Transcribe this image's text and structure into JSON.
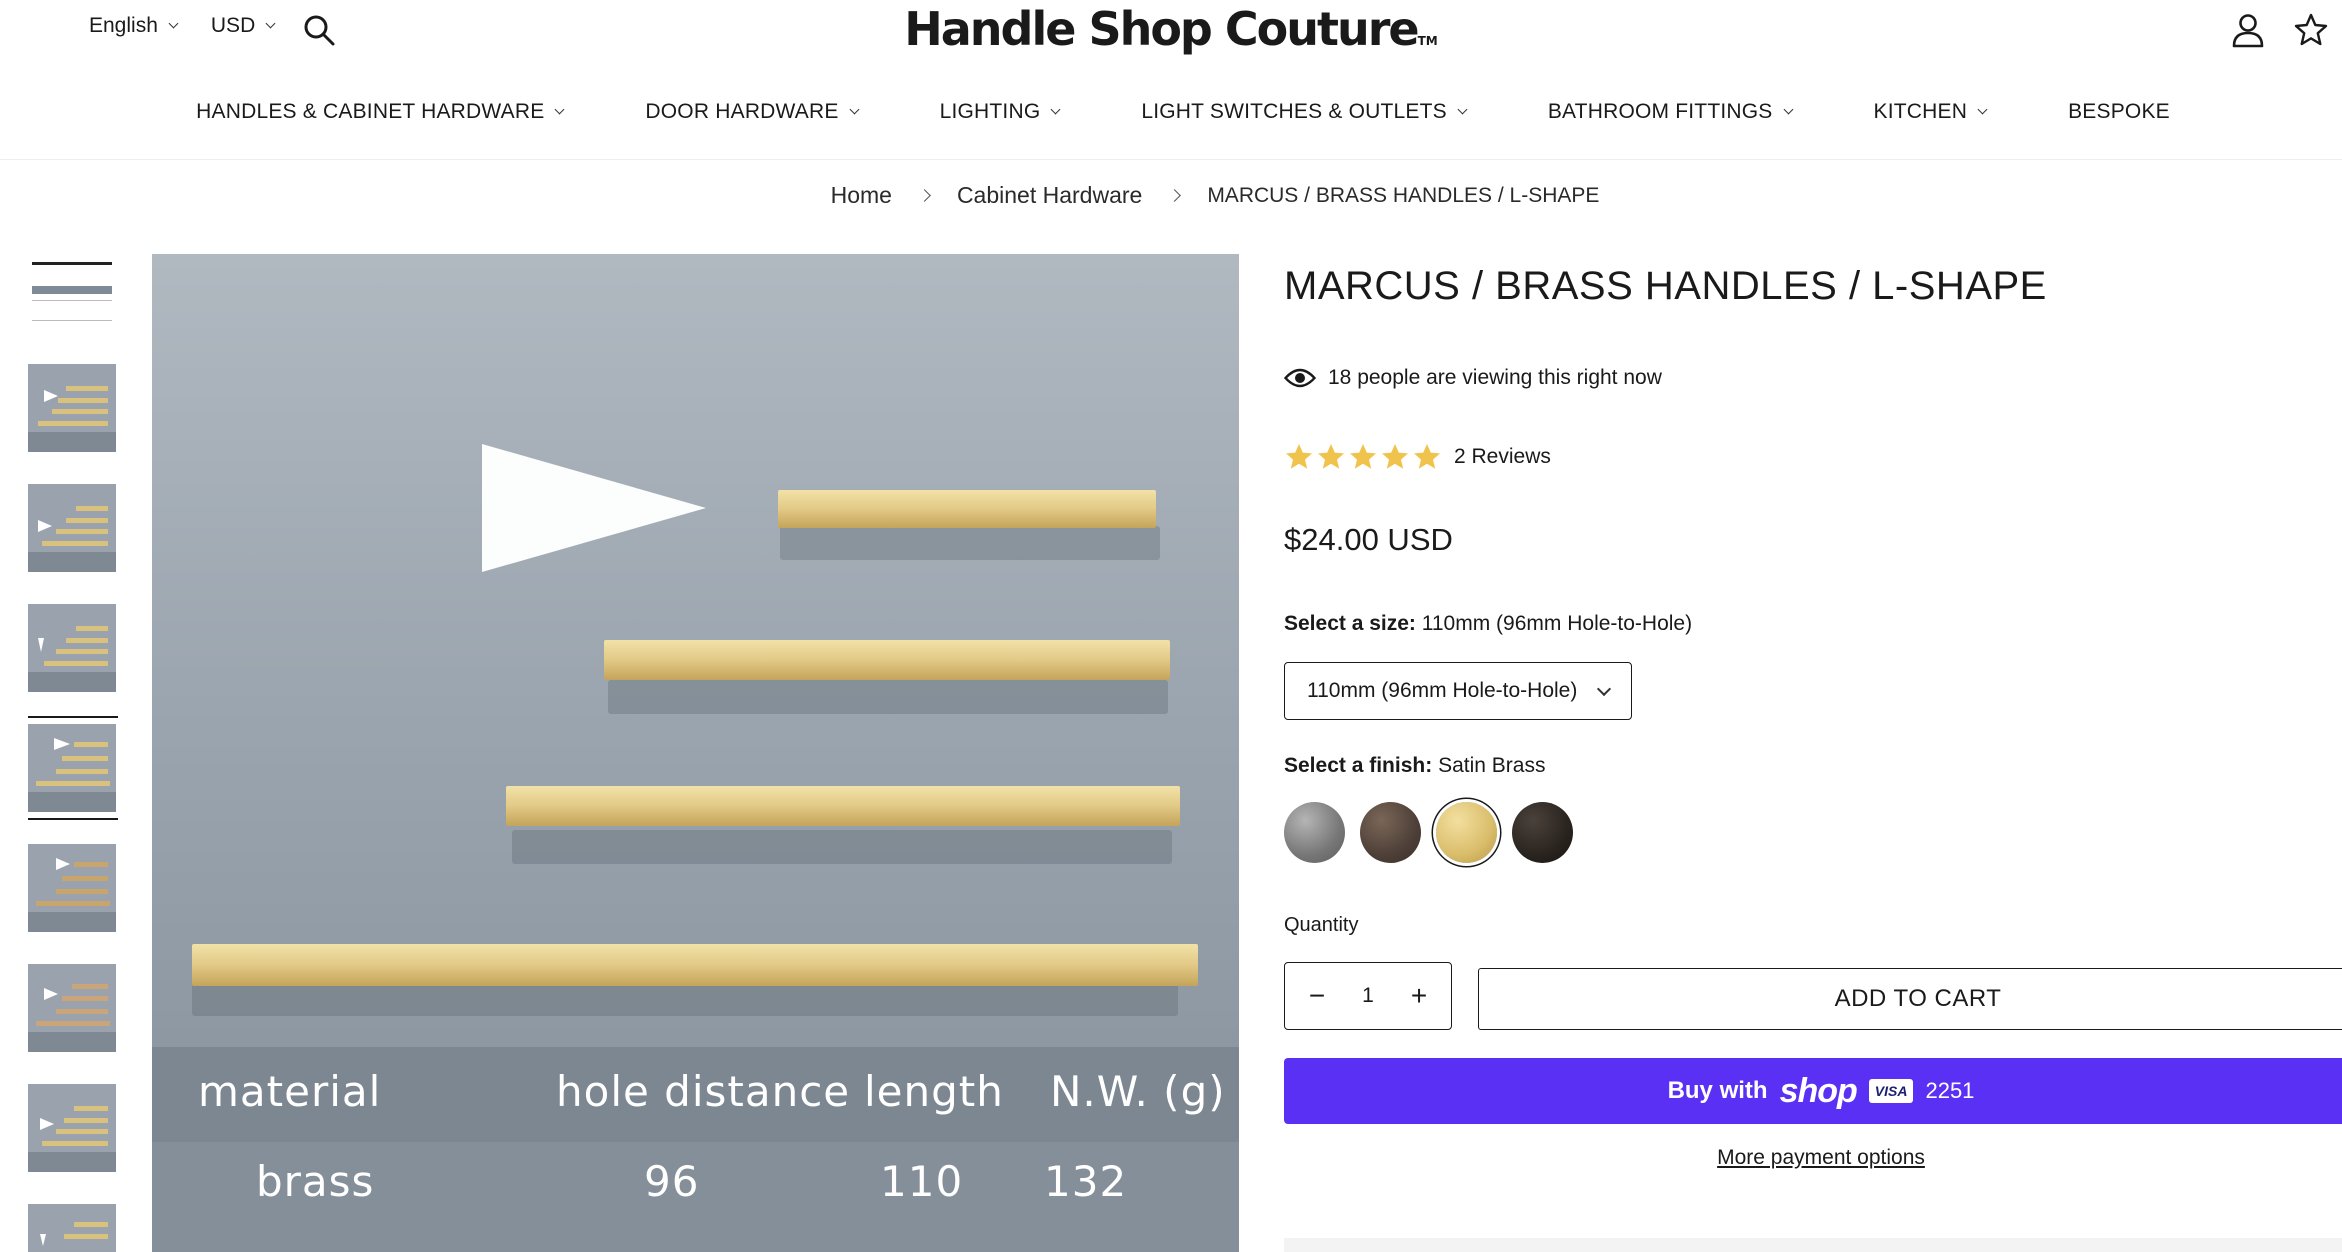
{
  "header": {
    "language": "English",
    "currency": "USD",
    "logo_text": "Handle Shop Couture",
    "logo_tm": "TM"
  },
  "nav": {
    "items": [
      {
        "label": "HANDLES & CABINET HARDWARE",
        "has_dropdown": true
      },
      {
        "label": "DOOR HARDWARE",
        "has_dropdown": true
      },
      {
        "label": "LIGHTING",
        "has_dropdown": true
      },
      {
        "label": "LIGHT SWITCHES & OUTLETS",
        "has_dropdown": true
      },
      {
        "label": "BATHROOM FITTINGS",
        "has_dropdown": true
      },
      {
        "label": "KITCHEN",
        "has_dropdown": true
      },
      {
        "label": "BESPOKE",
        "has_dropdown": false
      }
    ]
  },
  "breadcrumb": {
    "home": "Home",
    "category": "Cabinet Hardware",
    "current": "MARCUS / BRASS HANDLES / L-SHAPE"
  },
  "gallery": {
    "thumbnail_count": 9,
    "active_index": 4,
    "spec_headers": [
      "material",
      "hole distance",
      "length",
      "N.W. (g)"
    ],
    "spec_values": [
      "brass",
      "96",
      "110",
      "132"
    ]
  },
  "product": {
    "title": "MARCUS / BRASS HANDLES / L-SHAPE",
    "viewing_text": "18 people are viewing this right now",
    "rating": 5,
    "reviews_text": "2 Reviews",
    "price": "$24.00 USD",
    "size_label": "Select a size:",
    "size_value": "110mm (96mm Hole-to-Hole)",
    "size_selected": "110mm (96mm Hole-to-Hole)",
    "finish_label": "Select a finish:",
    "finish_value": "Satin Brass",
    "finishes": [
      {
        "name": "Chrome",
        "color": "#8a8a8a"
      },
      {
        "name": "Bronze",
        "color": "#4e4038"
      },
      {
        "name": "Satin Brass",
        "color": "#d9bd6a"
      },
      {
        "name": "Black",
        "color": "#2a241f"
      }
    ],
    "finish_selected_index": 2,
    "quantity_label": "Quantity",
    "quantity": "1",
    "add_to_cart": "ADD TO CART",
    "shop_pay": {
      "buy_with": "Buy with",
      "brand": "shop",
      "card": "VISA",
      "last4": "2251"
    },
    "more_payment": "More payment options"
  },
  "colors": {
    "shop_pay_purple": "#5a31f4",
    "star_gold": "#f0c44c"
  }
}
